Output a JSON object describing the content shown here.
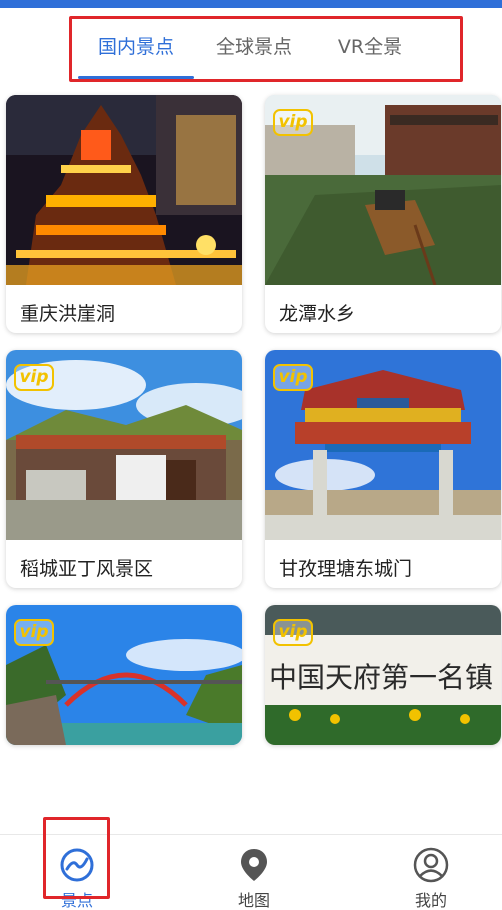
{
  "tabs": [
    {
      "label": "国内景点",
      "active": true
    },
    {
      "label": "全球景点",
      "active": false
    },
    {
      "label": "VR全景",
      "active": false
    }
  ],
  "vip_badge": "vip",
  "spots": [
    {
      "title": "重庆洪崖洞",
      "vip": false
    },
    {
      "title": "龙潭水乡",
      "vip": true
    },
    {
      "title": "稻城亚丁风景区",
      "vip": true
    },
    {
      "title": "甘孜理塘东城门",
      "vip": true
    },
    {
      "title": "",
      "vip": true
    },
    {
      "title": "",
      "vip": true
    }
  ],
  "bottom_nav": [
    {
      "label": "景点",
      "icon": "globe-icon",
      "active": true
    },
    {
      "label": "地图",
      "icon": "map-pin-icon",
      "active": false
    },
    {
      "label": "我的",
      "icon": "user-icon",
      "active": false
    }
  ],
  "colors": {
    "accent": "#2f6fd8",
    "highlight": "#e0262a",
    "vip": "#f2c200"
  }
}
